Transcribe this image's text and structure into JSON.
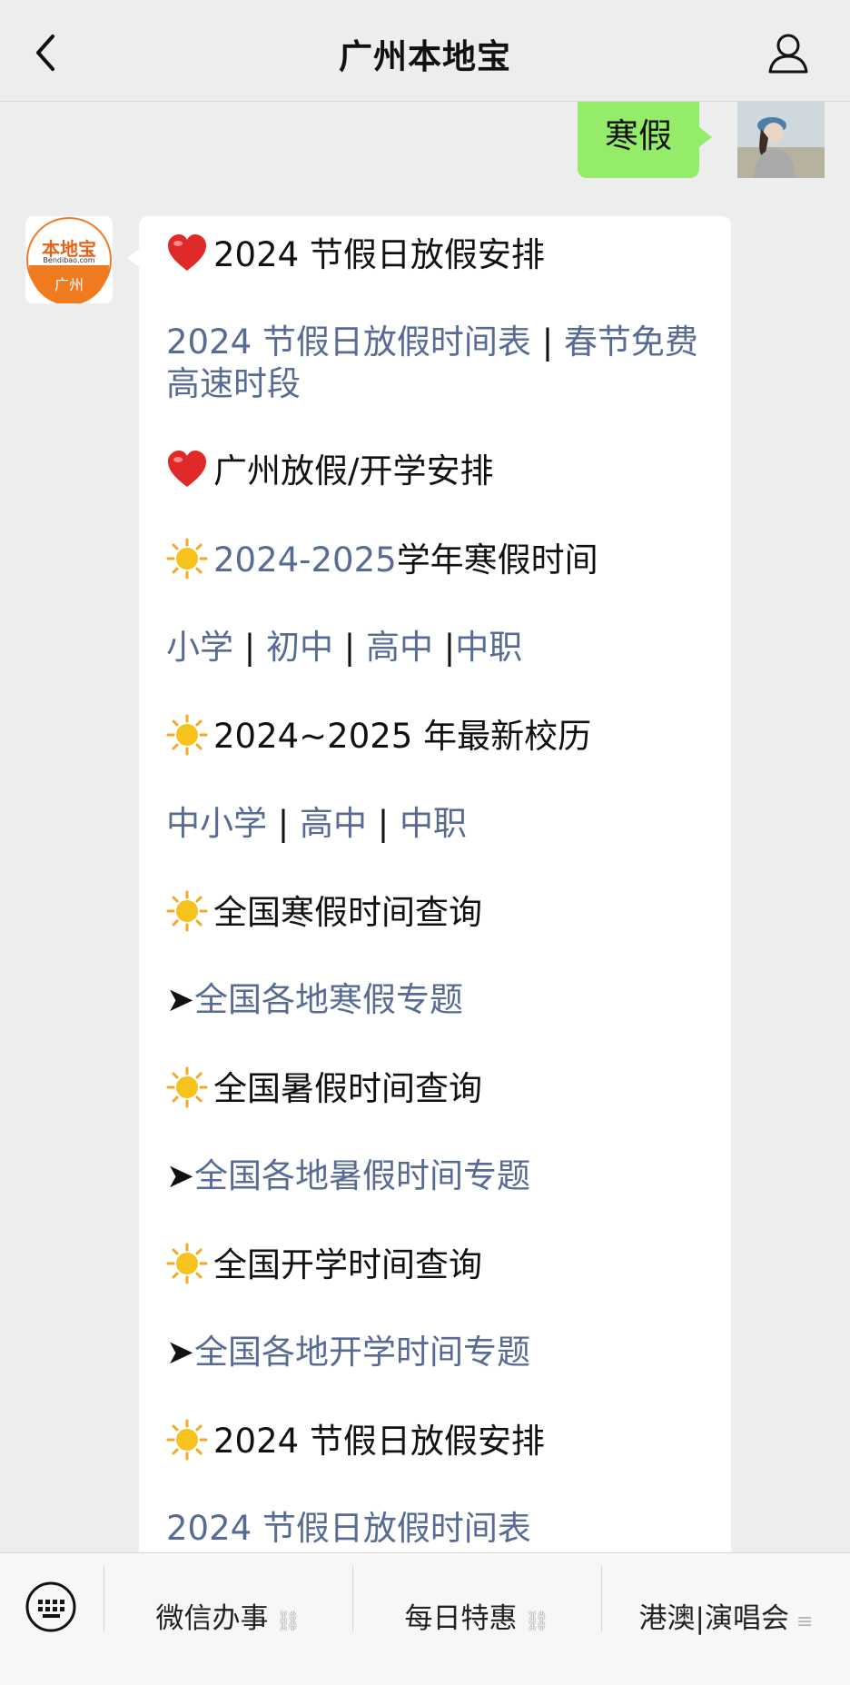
{
  "header": {
    "title": "广州本地宝"
  },
  "user_message": {
    "text": "寒假"
  },
  "bot": {
    "avatar_logo": {
      "top_text": "本地宝",
      "sub_text": "Bendibao.com",
      "city": "广州"
    },
    "lines": [
      {
        "emoji": "heart-icon",
        "text": "2024 节假日放假安排"
      },
      {
        "links": [
          "2024 节假日放假时间表",
          "春节免费高速时段"
        ]
      },
      {
        "emoji": "heart-icon",
        "text": "广州放假/开学安排"
      },
      {
        "emoji": "sun-icon",
        "link": "2024-2025",
        "text": "学年寒假时间"
      },
      {
        "links": [
          "小学",
          "初中",
          "高中",
          "中职"
        ]
      },
      {
        "emoji": "sun-icon",
        "text": "2024~2025 年最新校历"
      },
      {
        "links": [
          "中小学",
          "高中",
          "中职"
        ]
      },
      {
        "emoji": "sun-icon",
        "text": "全国寒假时间查询"
      },
      {
        "arrow": "➤",
        "link": "全国各地寒假专题"
      },
      {
        "emoji": "sun-icon",
        "text": "全国暑假时间查询"
      },
      {
        "arrow": "➤",
        "link": "全国各地暑假时间专题"
      },
      {
        "emoji": "sun-icon",
        "text": "全国开学时间查询"
      },
      {
        "arrow": "➤",
        "link": "全国各地开学时间专题"
      },
      {
        "emoji": "sun-icon",
        "text": "2024 节假日放假安排"
      },
      {
        "links": [
          "2024 节假日放假时间表"
        ]
      }
    ]
  },
  "bottom_menu": {
    "items": [
      {
        "label": "微信办事",
        "icon": "link-icon"
      },
      {
        "label": "每日特惠",
        "icon": "link-icon"
      },
      {
        "label": "港澳|演唱会",
        "icon": "menu-lines-icon"
      }
    ]
  },
  "colors": {
    "link": "#576b95",
    "user_bubble": "#95ec69",
    "background": "#ededed"
  }
}
